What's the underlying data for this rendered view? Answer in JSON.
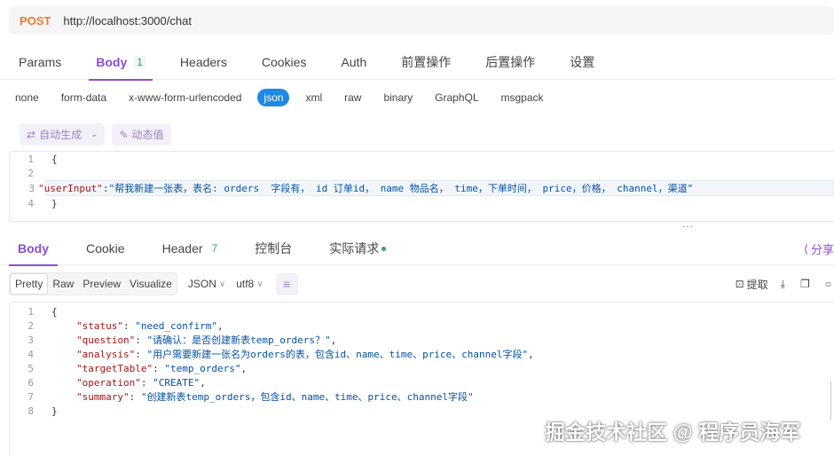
{
  "request": {
    "method": "POST",
    "url": "http://localhost:3000/chat"
  },
  "request_tabs": [
    {
      "label": "Params"
    },
    {
      "label": "Body",
      "count": "1"
    },
    {
      "label": "Headers"
    },
    {
      "label": "Cookies"
    },
    {
      "label": "Auth"
    },
    {
      "label": "前置操作"
    },
    {
      "label": "后置操作"
    },
    {
      "label": "设置"
    }
  ],
  "body_types": [
    "none",
    "form-data",
    "x-www-form-urlencoded",
    "json",
    "xml",
    "raw",
    "binary",
    "GraphQL",
    "msgpack"
  ],
  "body_tools": {
    "auto_generate": "自动生成",
    "dynamic_value": "动态值"
  },
  "request_body": {
    "line_numbers": [
      "1",
      "2",
      "3",
      "4"
    ],
    "open": "{",
    "key": "\"userInput\"",
    "colon": ":",
    "value": "\"帮我新建一张表，表名: orders  字段有， id 订单id， name 物品名， time，下单时间， price，价格， channel，渠道\"",
    "close": "}"
  },
  "response_tabs": [
    {
      "label": "Body"
    },
    {
      "label": "Cookie"
    },
    {
      "label": "Header",
      "count": "7"
    },
    {
      "label": "控制台"
    },
    {
      "label": "实际请求"
    }
  ],
  "share_label": "分享",
  "view_modes": [
    "Pretty",
    "Raw",
    "Preview",
    "Visualize"
  ],
  "format_select": "JSON",
  "encoding_select": "utf8",
  "extract_label": "提取",
  "response_body": {
    "line_numbers": [
      "1",
      "2",
      "3",
      "4",
      "5",
      "6",
      "7",
      "8"
    ],
    "open": "{",
    "lines": [
      {
        "key": "\"status\"",
        "value": "\"need_confirm\"",
        "comma": ","
      },
      {
        "key": "\"question\"",
        "value": "\"请确认：是否创建新表temp_orders？\"",
        "comma": ","
      },
      {
        "key": "\"analysis\"",
        "value": "\"用户需要新建一张名为orders的表，包含id、name、time、price、channel字段\"",
        "comma": ","
      },
      {
        "key": "\"targetTable\"",
        "value": "\"temp_orders\"",
        "comma": ","
      },
      {
        "key": "\"operation\"",
        "value": "\"CREATE\"",
        "comma": ","
      },
      {
        "key": "\"summary\"",
        "value": "\"创建新表temp_orders，包含id、name、time、price、channel字段\"",
        "comma": ""
      }
    ],
    "close": "}"
  },
  "watermark": "掘金技术社区 @ 程序员海军",
  "colors": {
    "method": "#f0782c",
    "accent": "#8a4fd1",
    "json_active": "#1e88e5",
    "json_key": "#a31515",
    "json_string": "#0451a5",
    "count_green": "#3aa35b"
  }
}
